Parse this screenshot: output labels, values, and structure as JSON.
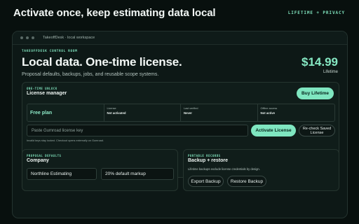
{
  "page": {
    "headline": "Activate once, keep estimating data local",
    "badge": "LIFETIME + PRIVACY"
  },
  "window": {
    "title": "TakeoffDesk · local workspace"
  },
  "hero": {
    "eyebrow": "TAKEOFFDESK CONTROL ROOM",
    "title": "Local data. One-time license.",
    "subtitle": "Proposal defaults, backups, jobs, and reusable scope systems.",
    "price": "$14.99",
    "price_caption": "Lifetime"
  },
  "license": {
    "eyebrow": "ONE-TIME UNLOCK",
    "title": "License manager",
    "buy_label": "Buy Lifetime",
    "plan": "Free plan",
    "status": [
      {
        "label": "License",
        "value": "Not activated"
      },
      {
        "label": "Last verified",
        "value": "Never"
      },
      {
        "label": "Offline access",
        "value": "Not active"
      }
    ],
    "input_placeholder": "Paste Gumroad license key",
    "activate_label": "Activate License",
    "recheck_label": "Re-check Saved License",
    "hint": "Invalid keys stay locked. Checkout opens externally on Gumroad."
  },
  "company": {
    "eyebrow": "PROPOSAL DEFAULTS",
    "title": "Company",
    "company_value": "Northline Estimating",
    "markup_value": "20% default markup"
  },
  "backup": {
    "eyebrow": "PORTABLE RECORDS",
    "title": "Backup + restore",
    "note": "Lifetime backups exclude license credentials by design.",
    "export_label": "Export Backup",
    "restore_label": "Restore Backup"
  },
  "colors": {
    "accent": "#7fe6c0",
    "background": "#08100e",
    "card": "#101d1a"
  }
}
